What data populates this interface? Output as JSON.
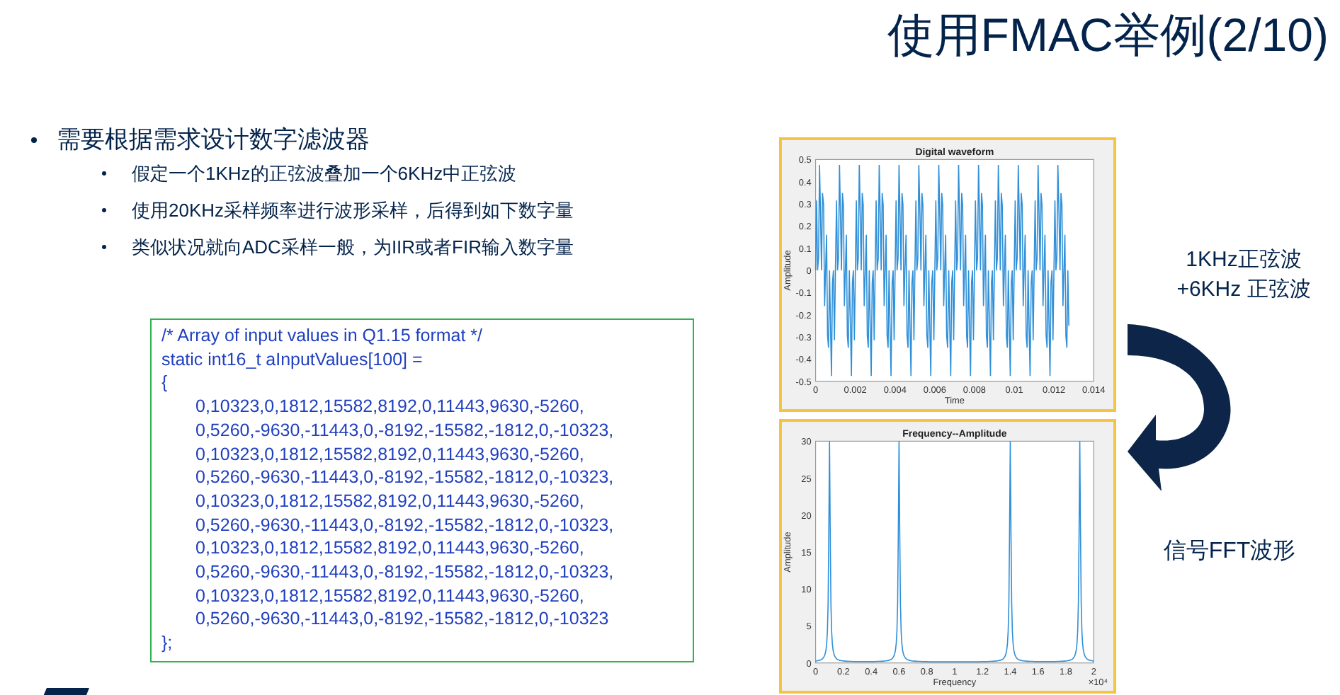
{
  "title": "使用FMAC举例(2/10)",
  "bullets": [
    {
      "text": "需要根据需求设计数字滤波器",
      "children": [
        {
          "text": "假定一个1KHz的正弦波叠加一个6KHz中正弦波"
        },
        {
          "text": "使用20KHz采样频率进行波形采样，后得到如下数字量"
        },
        {
          "text": "类似状况就向ADC采样一般，为IIR或者FIR输入数字量"
        }
      ]
    }
  ],
  "code_block": {
    "lines": [
      {
        "kind": "statement",
        "text": "/* Array of input values in Q1.15 format */"
      },
      {
        "kind": "statement",
        "text": "static int16_t aInputValues[100] ="
      },
      {
        "kind": "statement",
        "text": "{"
      },
      {
        "kind": "values",
        "text": "0,10323,0,1812,15582,8192,0,11443,9630,-5260,"
      },
      {
        "kind": "values",
        "text": "0,5260,-9630,-11443,0,-8192,-15582,-1812,0,-10323,"
      },
      {
        "kind": "values",
        "text": "0,10323,0,1812,15582,8192,0,11443,9630,-5260,"
      },
      {
        "kind": "values",
        "text": "0,5260,-9630,-11443,0,-8192,-15582,-1812,0,-10323,"
      },
      {
        "kind": "values",
        "text": "0,10323,0,1812,15582,8192,0,11443,9630,-5260,"
      },
      {
        "kind": "values",
        "text": "0,5260,-9630,-11443,0,-8192,-15582,-1812,0,-10323,"
      },
      {
        "kind": "values",
        "text": "0,10323,0,1812,15582,8192,0,11443,9630,-5260,"
      },
      {
        "kind": "values",
        "text": "0,5260,-9630,-11443,0,-8192,-15582,-1812,0,-10323,"
      },
      {
        "kind": "values",
        "text": "0,10323,0,1812,15582,8192,0,11443,9630,-5260,"
      },
      {
        "kind": "values",
        "text": "0,5260,-9630,-11443,0,-8192,-15582,-1812,0,-10323"
      },
      {
        "kind": "statement",
        "text": "};"
      }
    ]
  },
  "charts": [
    {
      "kind": "waveform",
      "chart_data": {
        "type": "line",
        "xlim": [
          0,
          0.014
        ],
        "ylim": [
          -0.5,
          0.5
        ],
        "xticks": [
          0,
          0.002,
          0.004,
          0.006,
          0.008,
          0.01,
          0.012,
          0.014
        ],
        "yticks": [
          -0.5,
          -0.4,
          -0.3,
          -0.2,
          -0.1,
          0,
          0.1,
          0.2,
          0.3,
          0.4,
          0.5
        ],
        "x": [
          0,
          5e-05,
          0.0001,
          0.00015,
          0.0002,
          0.00025,
          0.0003,
          0.00035,
          0.0004,
          0.00045,
          0.0005,
          0.00055,
          0.0006,
          0.00065,
          0.0007,
          0.00075,
          0.0008,
          0.00085,
          0.0009,
          0.00095,
          0.001,
          0.00105,
          0.0011,
          0.00115,
          0.0012,
          0.00125,
          0.0013,
          0.00135,
          0.0014,
          0.00145,
          0.0015,
          0.00155,
          0.0016,
          0.00165,
          0.0017,
          0.00175,
          0.0018,
          0.00185,
          0.0019,
          0.00195,
          0.002,
          0.00205,
          0.0021,
          0.00215,
          0.0022,
          0.00225,
          0.0023,
          0.00235,
          0.0024,
          0.00245,
          0.0025,
          0.00255,
          0.0026,
          0.00265,
          0.0027,
          0.00275,
          0.0028,
          0.00285,
          0.0029,
          0.00295,
          0.003,
          0.00305,
          0.0031,
          0.00315,
          0.0032,
          0.00325,
          0.0033,
          0.00335,
          0.0034,
          0.00345,
          0.0035,
          0.00355,
          0.0036,
          0.00365,
          0.0037,
          0.00375,
          0.0038,
          0.00385,
          0.0039,
          0.00395,
          0.004,
          0.00405,
          0.0041,
          0.00415,
          0.0042,
          0.00425,
          0.0043,
          0.00435,
          0.0044,
          0.00445,
          0.0045,
          0.00455,
          0.0046,
          0.00465,
          0.0047,
          0.00475,
          0.0048,
          0.00485,
          0.0049,
          0.00495,
          0.005,
          0.00505,
          0.0051,
          0.00515,
          0.0052,
          0.00525,
          0.0053,
          0.00535,
          0.0054,
          0.00545,
          0.0055,
          0.00555,
          0.0056,
          0.00565,
          0.0057,
          0.00575,
          0.0058,
          0.00585,
          0.0059,
          0.00595,
          0.006,
          0.00605,
          0.0061,
          0.00615,
          0.0062,
          0.00625,
          0.0063,
          0.00635,
          0.0064,
          0.00645,
          0.0065,
          0.00655,
          0.0066,
          0.00665,
          0.0067,
          0.00675,
          0.0068,
          0.00685,
          0.0069,
          0.00695,
          0.007,
          0.00705,
          0.0071,
          0.00715,
          0.0072,
          0.00725,
          0.0073,
          0.00735,
          0.0074,
          0.00745,
          0.0075,
          0.00755,
          0.0076,
          0.00765,
          0.0077,
          0.00775,
          0.0078,
          0.00785,
          0.0079,
          0.00795,
          0.008,
          0.00805,
          0.0081,
          0.00815,
          0.0082,
          0.00825,
          0.0083,
          0.00835,
          0.0084,
          0.00845,
          0.0085,
          0.00855,
          0.0086,
          0.00865,
          0.0087,
          0.00875,
          0.0088,
          0.00885,
          0.0089,
          0.00895,
          0.009,
          0.00905,
          0.0091,
          0.00915,
          0.0092,
          0.00925,
          0.0093,
          0.00935,
          0.0094,
          0.00945,
          0.0095,
          0.00955,
          0.0096,
          0.00965,
          0.0097,
          0.00975,
          0.0098,
          0.00985,
          0.0099,
          0.00995,
          0.01,
          0.01005,
          0.0101,
          0.01015,
          0.0102,
          0.01025,
          0.0103,
          0.01035,
          0.0104,
          0.01045,
          0.0105,
          0.01055,
          0.0106,
          0.01065,
          0.0107,
          0.01075,
          0.0108,
          0.01085,
          0.0109,
          0.01095,
          0.011,
          0.01105,
          0.0111,
          0.01115,
          0.0112,
          0.01125,
          0.0113,
          0.01135,
          0.0114,
          0.01145,
          0.0115,
          0.01155,
          0.0116,
          0.01165,
          0.0117,
          0.01175,
          0.0118,
          0.01185,
          0.0119,
          0.01195,
          0.012,
          0.01205,
          0.0121,
          0.01215,
          0.0122,
          0.01225,
          0.0123,
          0.01235,
          0.0124,
          0.01245,
          0.0125,
          0.01255,
          0.0126,
          0.01265,
          0.0127,
          0.01275
        ],
        "values": [
          0,
          0.315,
          0,
          0.055,
          0.476,
          0.25,
          0,
          0.349,
          0.294,
          -0.161,
          0,
          0.161,
          -0.294,
          -0.349,
          0,
          -0.25,
          -0.476,
          -0.055,
          0,
          -0.315,
          0,
          0.315,
          0,
          0.055,
          0.476,
          0.25,
          0,
          0.349,
          0.294,
          -0.161,
          0,
          0.161,
          -0.294,
          -0.349,
          0,
          -0.25,
          -0.476,
          -0.055,
          0,
          -0.315,
          0,
          0.315,
          0,
          0.055,
          0.476,
          0.25,
          0,
          0.349,
          0.294,
          -0.161,
          0,
          0.161,
          -0.294,
          -0.349,
          0,
          -0.25,
          -0.476,
          -0.055,
          0,
          -0.315,
          0,
          0.315,
          0,
          0.055,
          0.476,
          0.25,
          0,
          0.349,
          0.294,
          -0.161,
          0,
          0.161,
          -0.294,
          -0.349,
          0,
          -0.25,
          -0.476,
          -0.055,
          0,
          -0.315,
          0,
          0.315,
          0,
          0.055,
          0.476,
          0.25,
          0,
          0.349,
          0.294,
          -0.161,
          0,
          0.161,
          -0.294,
          -0.349,
          0,
          -0.25,
          -0.476,
          -0.055,
          0,
          -0.315,
          0,
          0.315,
          0,
          0.055,
          0.476,
          0.25,
          0,
          0.349,
          0.294,
          -0.161,
          0,
          0.161,
          -0.294,
          -0.349,
          0,
          -0.25,
          -0.476,
          -0.055,
          0,
          -0.315,
          0,
          0.315,
          0,
          0.055,
          0.476,
          0.25,
          0,
          0.349,
          0.294,
          -0.161,
          0,
          0.161,
          -0.294,
          -0.349,
          0,
          -0.25,
          -0.476,
          -0.055,
          0,
          -0.315,
          0,
          0.315,
          0,
          0.055,
          0.476,
          0.25,
          0,
          0.349,
          0.294,
          -0.161,
          0,
          0.161,
          -0.294,
          -0.349,
          0,
          -0.25,
          -0.476,
          -0.055,
          0,
          -0.315,
          0,
          0.315,
          0,
          0.055,
          0.476,
          0.25,
          0,
          0.349,
          0.294,
          -0.161,
          0,
          0.161,
          -0.294,
          -0.349,
          0,
          -0.25,
          -0.476,
          -0.055,
          0,
          -0.315,
          0,
          0.315,
          0,
          0.055,
          0.476,
          0.25,
          0,
          0.349,
          0.294,
          -0.161,
          0,
          0.161,
          -0.294,
          -0.349,
          0,
          -0.25,
          -0.476,
          -0.055,
          0,
          -0.315,
          0,
          0.315,
          0,
          0.055,
          0.476,
          0.25,
          0,
          0.349,
          0.294,
          -0.161,
          0,
          0.161,
          -0.294,
          -0.349,
          0,
          -0.25,
          -0.476,
          -0.055,
          0,
          -0.315,
          0,
          0.315,
          0,
          0.055,
          0.476,
          0.25,
          0,
          0.349,
          0.294,
          -0.161,
          0,
          0.161,
          -0.294,
          -0.349,
          0,
          -0.25,
          -0.476,
          -0.055,
          0,
          -0.315,
          0,
          0.315,
          0,
          0.055,
          0.476,
          0.25,
          0,
          0.349,
          0.294,
          -0.161,
          0,
          0.161,
          -0.294,
          -0.349,
          0,
          -0.25
        ]
      },
      "title": "Digital waveform",
      "xlabel": "Time",
      "ylabel": "Amplitude"
    },
    {
      "kind": "spectrum",
      "title": "Frequency--Amplitude",
      "xlabel": "Frequency",
      "ylabel": "Amplitude",
      "xticks": [
        "0",
        "0.2",
        "0.4",
        "0.6",
        "0.8",
        "1",
        "1.2",
        "1.4",
        "1.6",
        "1.8",
        "2"
      ],
      "yticks": [
        "30",
        "25",
        "20",
        "15",
        "10",
        "5",
        "0"
      ],
      "axis_multiplier": "×10⁴"
    }
  ],
  "input_label": [
    "1KHz正弦波",
    "+6KHz 正弦波"
  ],
  "output_label": "信号FFT波形"
}
